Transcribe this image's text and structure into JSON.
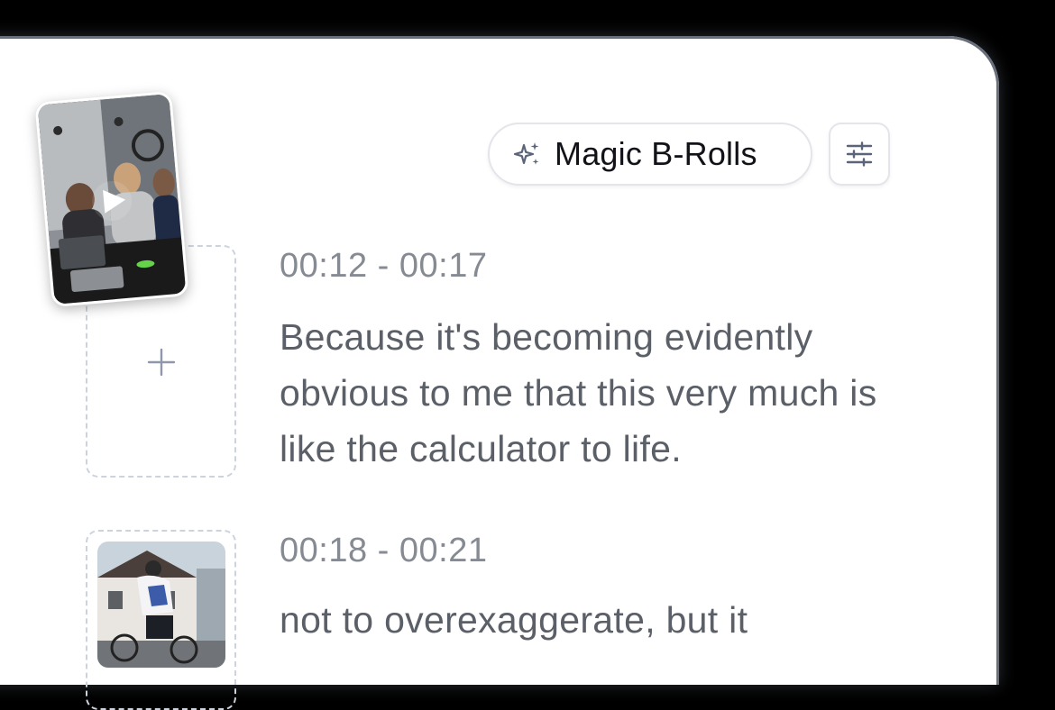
{
  "toolbar": {
    "magic_label": "Magic B-Rolls",
    "magic_icon": "sparkles-icon",
    "settings_icon": "sliders-icon"
  },
  "segments": [
    {
      "time": "00:12 - 00:17",
      "text": "Because it's becoming evidently obvious to me that this very much is like the calculator to life."
    },
    {
      "time": "00:18 - 00:21",
      "text": "not to overexaggerate, but it"
    }
  ],
  "colors": {
    "accent_icon": "#5b6478",
    "muted_text": "#868a92",
    "body_text": "#5b5f67",
    "dashed_border": "#cdd3dd"
  }
}
